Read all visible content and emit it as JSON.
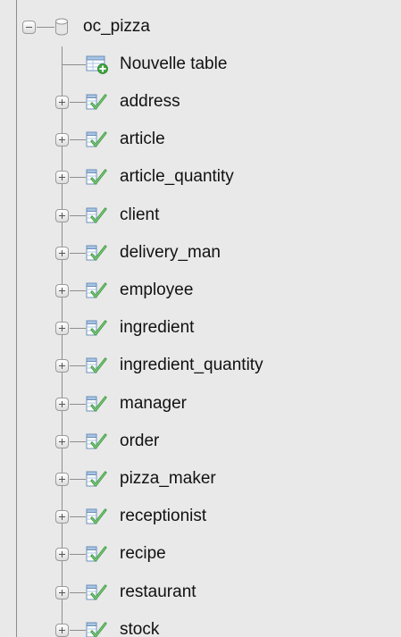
{
  "database": {
    "name": "oc_pizza",
    "expanded": true,
    "icon": "database-icon"
  },
  "new_table": {
    "label": "Nouvelle table",
    "icon": "new-table-icon"
  },
  "tables": [
    {
      "name": "address"
    },
    {
      "name": "article"
    },
    {
      "name": "article_quantity"
    },
    {
      "name": "client"
    },
    {
      "name": "delivery_man"
    },
    {
      "name": "employee"
    },
    {
      "name": "ingredient"
    },
    {
      "name": "ingredient_quantity"
    },
    {
      "name": "manager"
    },
    {
      "name": "order"
    },
    {
      "name": "pizza_maker"
    },
    {
      "name": "receptionist"
    },
    {
      "name": "recipe"
    },
    {
      "name": "restaurant"
    },
    {
      "name": "stock"
    }
  ],
  "colors": {
    "background": "#e9e9e9",
    "guide_line": "#8e8e8e",
    "table_icon_green": "#4caf50",
    "table_icon_blue": "#6fa8dc"
  }
}
